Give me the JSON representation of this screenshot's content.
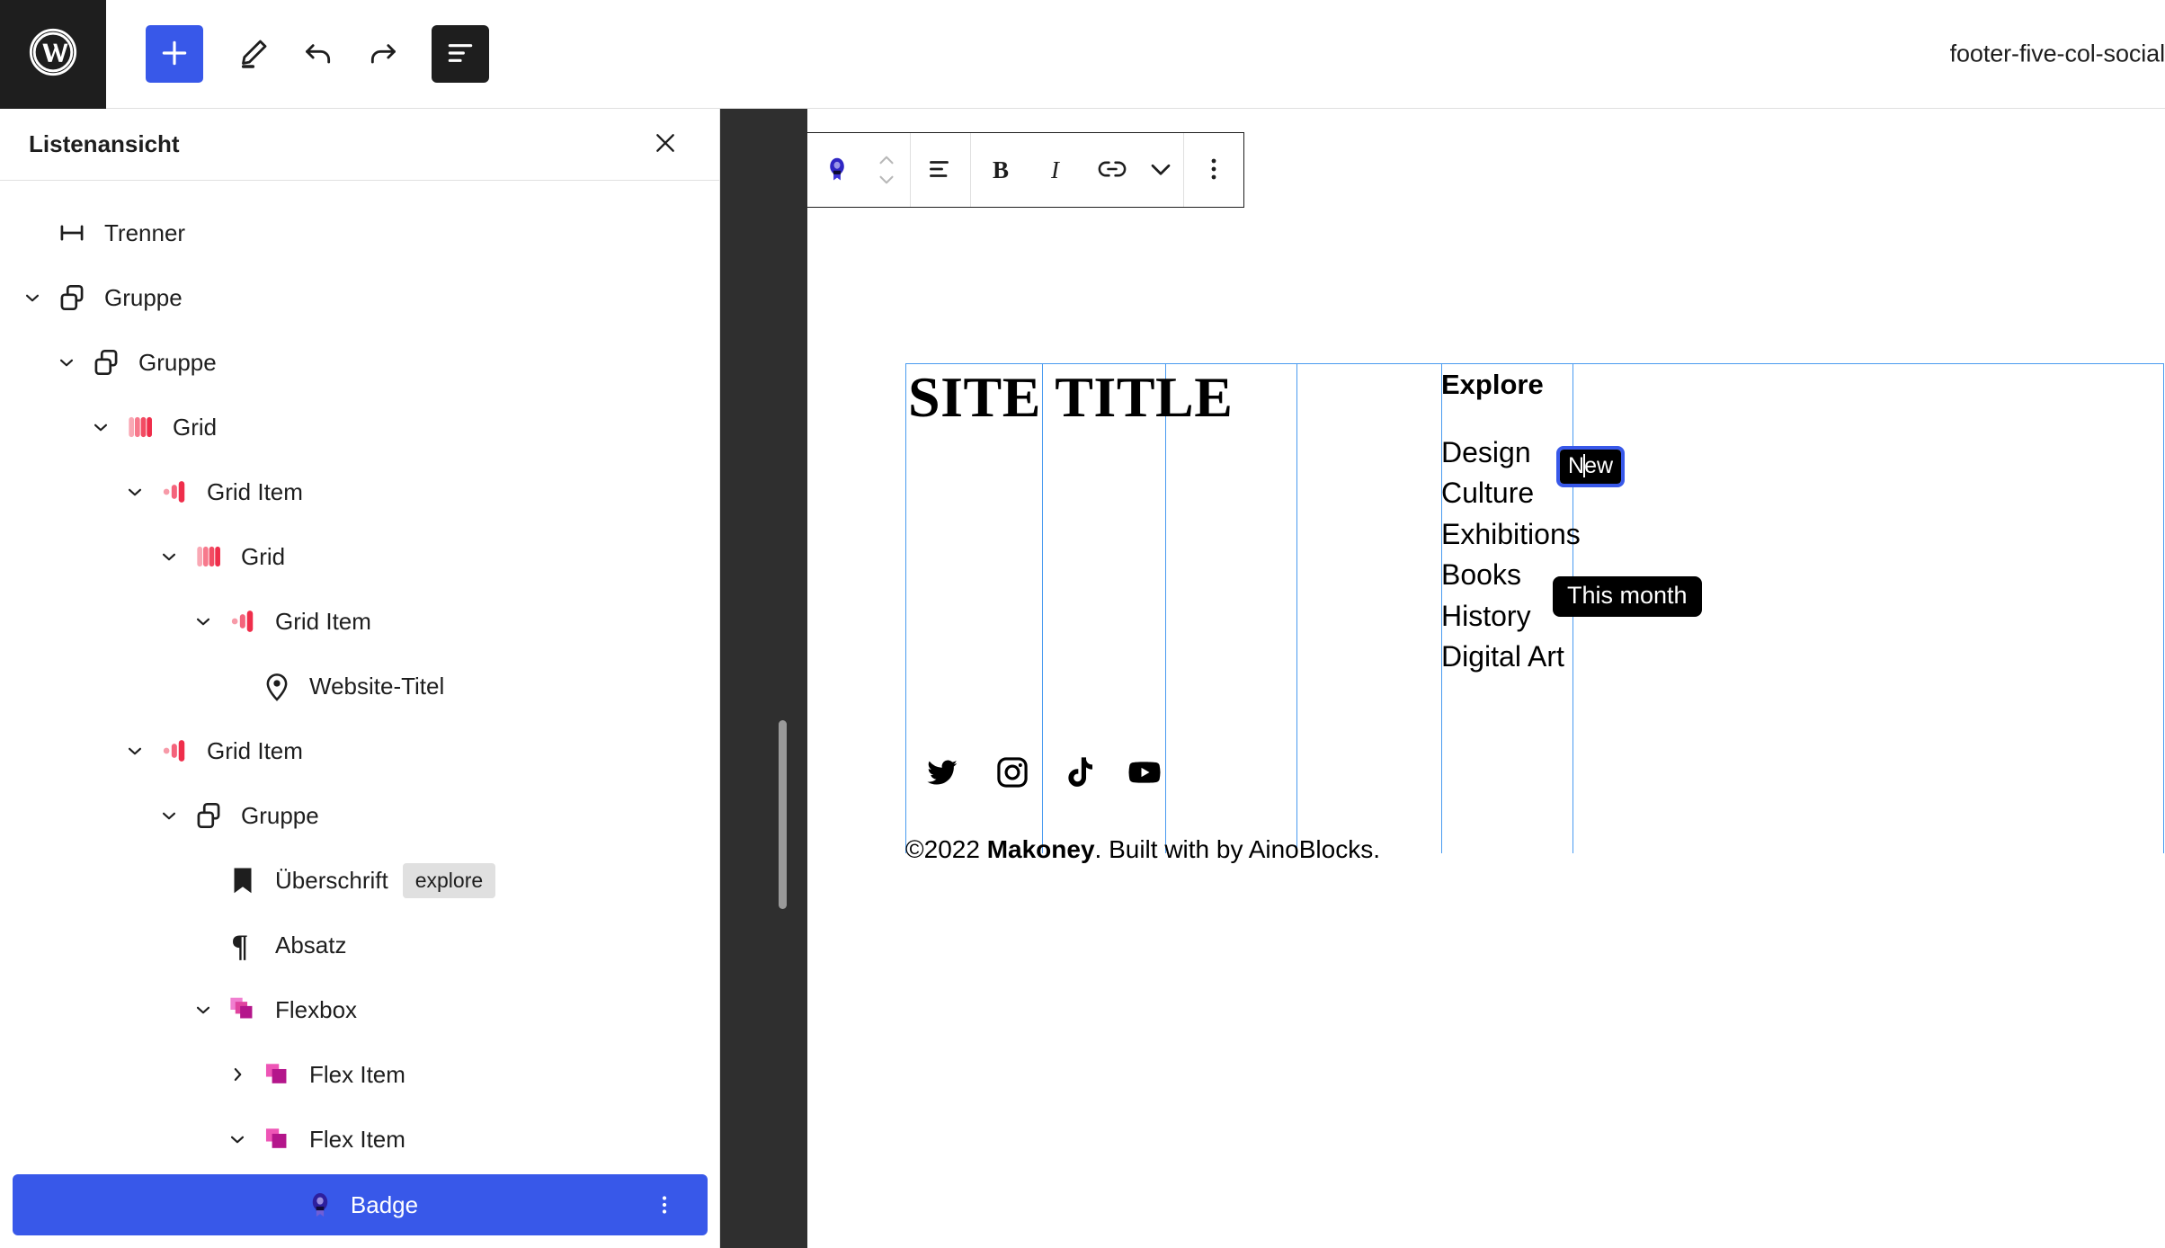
{
  "header": {
    "title": "footer-five-col-social",
    "logo_icon": "wordpress-logo-icon",
    "tools": [
      {
        "name": "add-block-button",
        "icon": "plus-icon",
        "label": "Block hinzufügen"
      },
      {
        "name": "edit-tool-button",
        "icon": "pencil-icon",
        "label": "Werkzeuge"
      },
      {
        "name": "undo-button",
        "icon": "undo-arrow-icon",
        "label": "Rückgängig"
      },
      {
        "name": "redo-button",
        "icon": "redo-arrow-icon",
        "label": "Wiederholen"
      },
      {
        "name": "list-view-button",
        "icon": "list-view-icon",
        "label": "Listenansicht"
      }
    ]
  },
  "listview": {
    "title": "Listenansicht",
    "close_icon": "close-icon",
    "items": [
      {
        "label": "Trenner",
        "icon": "separator-icon",
        "depth": 0,
        "chevron": "none",
        "tag": ""
      },
      {
        "label": "Gruppe",
        "icon": "group-icon",
        "depth": 0,
        "chevron": "down",
        "tag": ""
      },
      {
        "label": "Gruppe",
        "icon": "group-icon",
        "depth": 1,
        "chevron": "down",
        "tag": ""
      },
      {
        "label": "Grid",
        "icon": "grid-icon",
        "depth": 2,
        "chevron": "down",
        "tag": ""
      },
      {
        "label": "Grid Item",
        "icon": "grid-item-icon",
        "depth": 3,
        "chevron": "down",
        "tag": ""
      },
      {
        "label": "Grid",
        "icon": "grid-icon",
        "depth": 4,
        "chevron": "down",
        "tag": ""
      },
      {
        "label": "Grid Item",
        "icon": "grid-item-icon",
        "depth": 5,
        "chevron": "down",
        "tag": ""
      },
      {
        "label": "Website-Titel",
        "icon": "map-pin-icon",
        "depth": 6,
        "chevron": "none",
        "tag": ""
      },
      {
        "label": "Grid Item",
        "icon": "grid-item-icon",
        "depth": 3,
        "chevron": "down",
        "tag": ""
      },
      {
        "label": "Gruppe",
        "icon": "group-icon",
        "depth": 4,
        "chevron": "down",
        "tag": ""
      },
      {
        "label": "Überschrift",
        "icon": "bookmark-icon",
        "depth": 5,
        "chevron": "none",
        "tag": "explore"
      },
      {
        "label": "Absatz",
        "icon": "paragraph-icon",
        "depth": 5,
        "chevron": "none",
        "tag": ""
      },
      {
        "label": "Flexbox",
        "icon": "flexbox-icon",
        "depth": 5,
        "chevron": "down",
        "tag": ""
      },
      {
        "label": "Flex Item",
        "icon": "flex-item-icon",
        "depth": 6,
        "chevron": "right",
        "tag": ""
      },
      {
        "label": "Flex Item",
        "icon": "flex-item-icon",
        "depth": 6,
        "chevron": "down",
        "tag": ""
      }
    ],
    "selected": {
      "label": "Badge",
      "icon": "badge-award-icon",
      "more_icon": "more-vertical-icon",
      "background": "#3858e9"
    }
  },
  "block_toolbar": {
    "block_icon": "badge-award-icon",
    "move_up_icon": "chevron-up-icon",
    "move_down_icon": "chevron-down-icon",
    "buttons": [
      {
        "name": "align-button",
        "icon": "align-left-icon",
        "label": "Ausrichten"
      },
      {
        "name": "bold-button",
        "icon": "bold-icon",
        "label": "B"
      },
      {
        "name": "italic-button",
        "icon": "italic-icon",
        "label": "I"
      },
      {
        "name": "link-button",
        "icon": "link-icon",
        "label": "Link"
      },
      {
        "name": "more-rich-text-button",
        "icon": "chevron-down-icon",
        "label": "Mehr"
      },
      {
        "name": "block-options-button",
        "icon": "more-vertical-icon",
        "label": "Optionen"
      }
    ]
  },
  "canvas": {
    "site_title": "SITE TITLE",
    "explore_heading": "Explore",
    "nav_links": [
      "Design",
      "Culture",
      "Exhibitions",
      "Books",
      "History",
      "Digital Art"
    ],
    "badges": [
      {
        "name": "badge-new",
        "text": "New",
        "selected": true,
        "outline_color": "#3858e9"
      },
      {
        "name": "badge-this-month",
        "text": "This month",
        "selected": false,
        "outline_color": ""
      }
    ],
    "social_icons": [
      {
        "name": "twitter-icon",
        "label": "Twitter"
      },
      {
        "name": "instagram-icon",
        "label": "Instagram"
      },
      {
        "name": "tiktok-icon",
        "label": "TikTok"
      },
      {
        "name": "youtube-icon",
        "label": "YouTube"
      }
    ],
    "copyright": {
      "prefix": "©2022 ",
      "brand": "Makoney",
      "suffix": ". Built with by AinoBlocks."
    },
    "grid_guide_color": "#4a9bf0"
  }
}
